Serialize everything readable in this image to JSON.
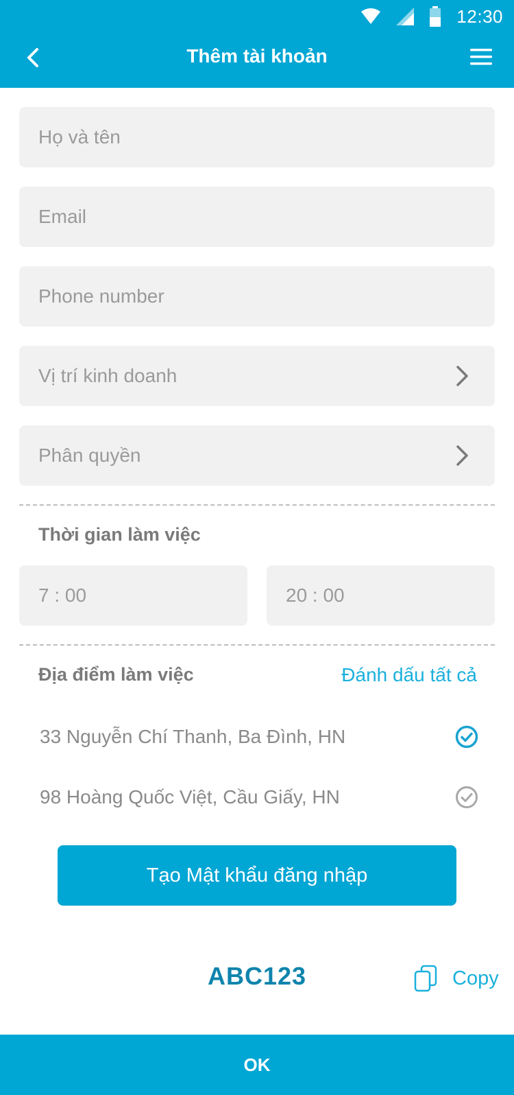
{
  "status_bar": {
    "time": "12:30",
    "icons": [
      "wifi-icon",
      "cellular-signal-icon",
      "battery-icon"
    ]
  },
  "header": {
    "title": "Thêm tài khoản",
    "back_icon": "chevron-left-icon",
    "menu_icon": "hamburger-menu-icon"
  },
  "form": {
    "full_name_placeholder": "Họ và tên",
    "email_placeholder": "Email",
    "phone_placeholder": "Phone number",
    "business_position_label": "Vị trí kinh doanh",
    "permission_label": "Phân quyền"
  },
  "working_time": {
    "title": "Thời gian làm việc",
    "start": "7 : 00",
    "end": "20 : 00"
  },
  "working_location": {
    "title": "Địa điểm làm việc",
    "mark_all_label": "Đánh dấu tất cả",
    "locations": [
      {
        "label": "33 Nguyễn Chí Thanh, Ba Đình, HN",
        "checked": true
      },
      {
        "label": "98 Hoàng Quốc Việt, Cầu Giấy, HN",
        "checked": false
      }
    ]
  },
  "generate_password_label": "Tạo Mật khẩu đăng nhập",
  "generated_password": "ABC123",
  "copy_label": "Copy",
  "ok_label": "OK",
  "colors": {
    "primary": "#00a6d4",
    "field_bg": "#f1f1f1",
    "password_text": "#0f84ad",
    "check_active": "#1aa3d1",
    "check_inactive": "#a8a8a8"
  }
}
